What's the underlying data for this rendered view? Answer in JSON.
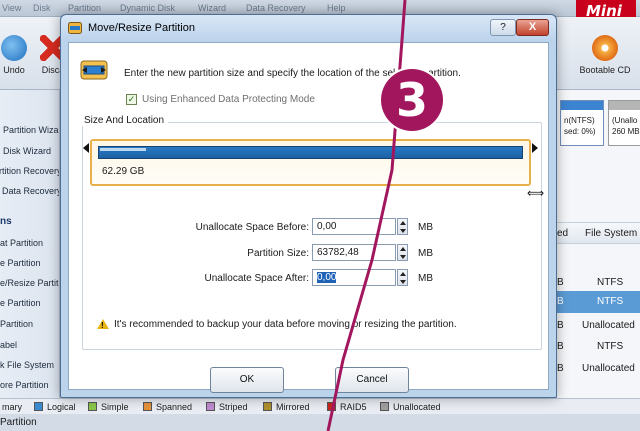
{
  "app": {
    "menu": [
      "Partition",
      "Dynamic Disk",
      "Wizard",
      "Data Recovery",
      "Help"
    ],
    "brand": "Mini T",
    "toolbar": [
      {
        "label": "Undo",
        "icon": "undo-icon"
      },
      {
        "label": "Disca",
        "icon": "discard-icon"
      },
      {
        "label": "Bootable CD",
        "icon": "bootable-cd-icon"
      }
    ],
    "sidebar": [
      {
        "label": "Partition Wiza",
        "kind": "item"
      },
      {
        "label": "Disk Wizard",
        "kind": "item"
      },
      {
        "label": "rtition Recovery W",
        "kind": "item"
      },
      {
        "label": "Data Recovery",
        "kind": "item"
      },
      {
        "label": "ns",
        "kind": "heading"
      },
      {
        "label": "at Partition",
        "kind": "item"
      },
      {
        "label": "e Partition",
        "kind": "item"
      },
      {
        "label": "e/Resize Partitio",
        "kind": "item"
      },
      {
        "label": "e Partition",
        "kind": "item"
      },
      {
        "label": "Partition",
        "kind": "item"
      },
      {
        "label": "abel",
        "kind": "item"
      },
      {
        "label": "k File System",
        "kind": "item"
      },
      {
        "label": "ore Partition",
        "kind": "item"
      }
    ],
    "disk_map": [
      {
        "line1": "n(NTFS)",
        "line2": "sed: 0%)"
      },
      {
        "line1": "(Unallo",
        "line2": "260 MB"
      }
    ],
    "table": {
      "headers": [
        "ed",
        "File System"
      ],
      "rows": [
        {
          "col1": "B",
          "fs": "NTFS",
          "selected": false
        },
        {
          "col1": "B",
          "fs": "NTFS",
          "selected": true
        },
        {
          "col1": "B",
          "fs": "Unallocated",
          "selected": false
        },
        {
          "col1": "B",
          "fs": "NTFS",
          "selected": false
        },
        {
          "col1": "B",
          "fs": "Unallocated",
          "selected": false
        }
      ]
    },
    "legend": [
      {
        "label": "mary",
        "color": "#1a3c8a"
      },
      {
        "label": "Logical",
        "color": "#3a8ad0"
      },
      {
        "label": "Simple",
        "color": "#8ac84a"
      },
      {
        "label": "Spanned",
        "color": "#e5913a"
      },
      {
        "label": "Striped",
        "color": "#c08ad0"
      },
      {
        "label": "Mirrored",
        "color": "#b0902e"
      },
      {
        "label": "RAID5",
        "color": "#c8281e"
      },
      {
        "label": "Unallocated",
        "color": "#a0a0a0"
      }
    ],
    "status": "Partition"
  },
  "dialog": {
    "title": "Move/Resize Partition",
    "help_label": "?",
    "close_label": "X",
    "intro": "Enter the new partition size and specify the location of the selected partition.",
    "protect_mode": {
      "label": "Using Enhanced Data Protecting Mode",
      "checked": true
    },
    "group_label": "Size And Location",
    "partition_size_label": "62.29 GB",
    "fields": [
      {
        "label": "Unallocate Space Before:",
        "value": "0,00",
        "unit": "MB"
      },
      {
        "label": "Partition Size:",
        "value": "63782,48",
        "unit": "MB"
      },
      {
        "label": "Unallocate Space After:",
        "value": "0,00",
        "unit": "MB"
      }
    ],
    "warning": "It's recommended to backup your data before moving or resizing the partition.",
    "ok_label": "OK",
    "cancel_label": "Cancel"
  },
  "annotation": {
    "step_number": "3",
    "color": "#a2165d"
  }
}
